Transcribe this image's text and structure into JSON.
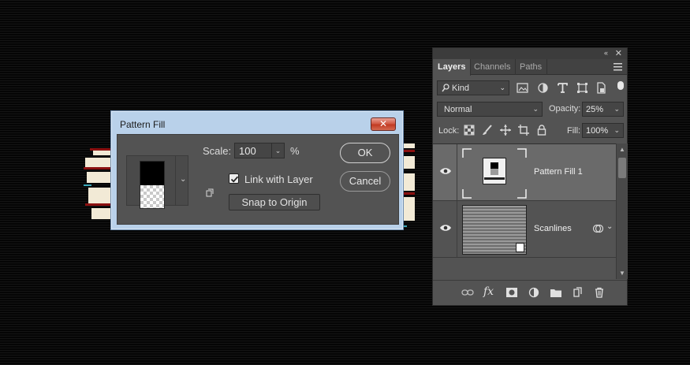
{
  "dialog": {
    "title": "Pattern Fill",
    "close_label": "✕",
    "scale_label": "Scale:",
    "scale_value": "100",
    "percent_sign": "%",
    "link_with_layer_label": "Link with Layer",
    "link_with_layer_checked": true,
    "snap_to_origin_label": "Snap to Origin",
    "ok_label": "OK",
    "cancel_label": "Cancel"
  },
  "layers_panel": {
    "tabs": [
      "Layers",
      "Channels",
      "Paths"
    ],
    "active_tab": "Layers",
    "filter_kind": "Kind",
    "blend_mode": "Normal",
    "opacity_label": "Opacity:",
    "opacity_value": "25%",
    "lock_label": "Lock:",
    "fill_label": "Fill:",
    "fill_value": "100%",
    "layers": [
      {
        "name": "Pattern Fill 1",
        "selected": true,
        "visible": true
      },
      {
        "name": "Scanlines",
        "selected": false,
        "visible": true
      }
    ],
    "footer_fx_label": "fx"
  },
  "colors": {
    "panel_bg": "#535353",
    "selected_layer_bg": "#6a6a6a",
    "dialog_frame": "#b9d1ea",
    "close_button": "#c9452d"
  }
}
